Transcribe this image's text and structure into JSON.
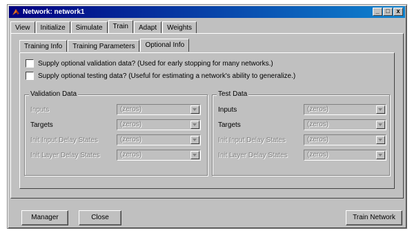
{
  "window": {
    "title": "Network: network1",
    "controls": [
      "_",
      "□",
      "x"
    ]
  },
  "main_tabs": [
    {
      "label": "View",
      "active": false
    },
    {
      "label": "Initialize",
      "active": false
    },
    {
      "label": "Simulate",
      "active": false
    },
    {
      "label": "Train",
      "active": true
    },
    {
      "label": "Adapt",
      "active": false
    },
    {
      "label": "Weights",
      "active": false
    }
  ],
  "sub_tabs": [
    {
      "label": "Training Info",
      "active": false
    },
    {
      "label": "Training Parameters",
      "active": false
    },
    {
      "label": "Optional Info",
      "active": true
    }
  ],
  "options": {
    "validation": {
      "label": "Supply optional validation data? (Used for early stopping for many networks.)",
      "checked": false
    },
    "testing": {
      "label": "Supply optional testing data? (Useful for estimating a network's ability to generalize.)",
      "checked": false
    }
  },
  "validation_group": {
    "title": "Validation Data",
    "inputs_label": "Inputs",
    "inputs_value": "(zeros)",
    "targets_label": "Targets",
    "targets_value": "(zeros)",
    "init_input_delay_label": "Init Input Delay States",
    "init_input_delay_value": "(zeros)",
    "init_layer_delay_label": "Init Layer Delay States",
    "init_layer_delay_value": "(zeros)"
  },
  "test_group": {
    "title": "Test Data",
    "inputs_label": "Inputs",
    "inputs_value": "(zeros)",
    "targets_label": "Targets",
    "targets_value": "(zeros)",
    "init_input_delay_label": "Init Input Delay States",
    "init_input_delay_value": "(zeros)",
    "init_layer_delay_label": "Init Layer Delay States",
    "init_layer_delay_value": "(zeros)"
  },
  "buttons": {
    "manager": "Manager",
    "close": "Close",
    "train_network": "Train Network"
  },
  "colors": {
    "face": "#c0c0c0",
    "titlebar_start": "#000080",
    "titlebar_end": "#1084d0",
    "disabled_text": "#808080"
  }
}
